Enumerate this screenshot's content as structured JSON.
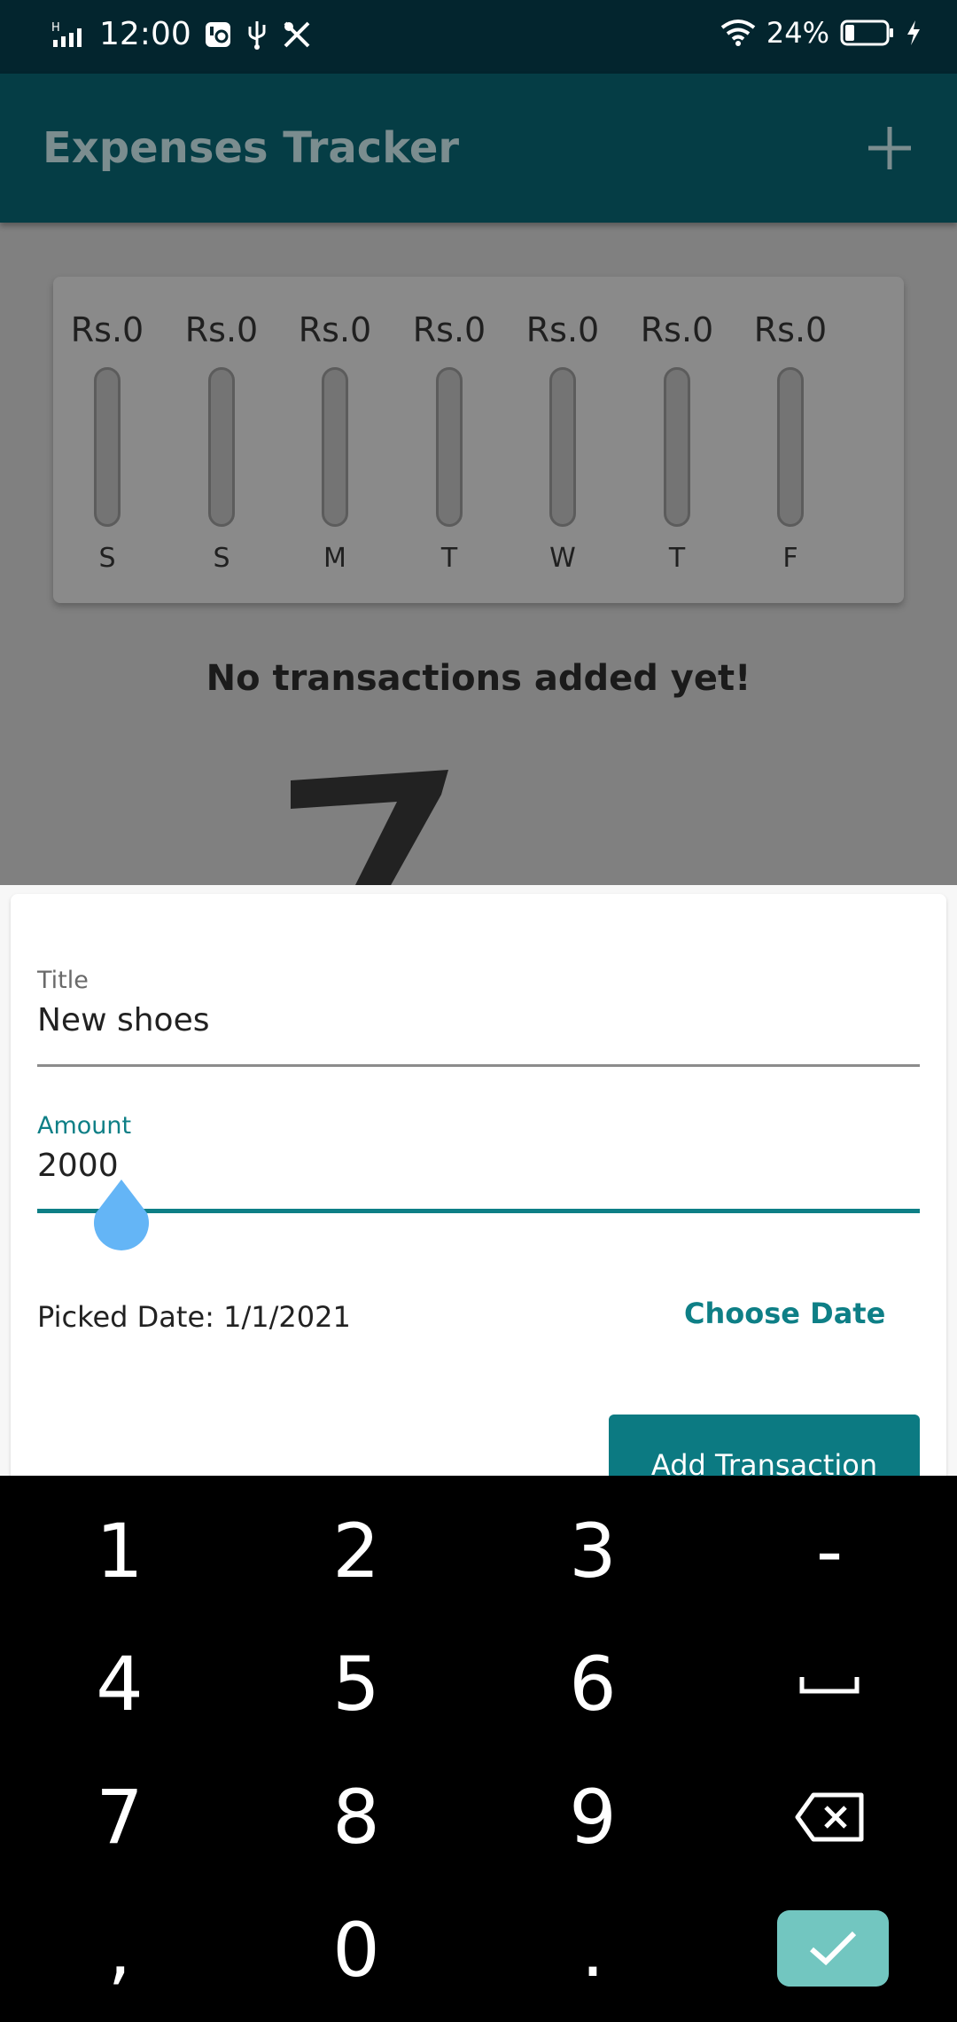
{
  "status_bar": {
    "time": "12:00",
    "battery_percent": "24%",
    "network": "H",
    "icons": [
      "signal-icon",
      "settings-chip-icon",
      "usb-icon",
      "tools-icon",
      "wifi-icon",
      "battery-icon",
      "charging-icon"
    ]
  },
  "app_bar": {
    "title": "Expenses Tracker",
    "add_icon": "plus-icon"
  },
  "chart": {
    "bars": [
      {
        "amount": "Rs.0",
        "day": "S",
        "fill_fraction": 0
      },
      {
        "amount": "Rs.0",
        "day": "S",
        "fill_fraction": 0
      },
      {
        "amount": "Rs.0",
        "day": "M",
        "fill_fraction": 0
      },
      {
        "amount": "Rs.0",
        "day": "T",
        "fill_fraction": 0
      },
      {
        "amount": "Rs.0",
        "day": "W",
        "fill_fraction": 0
      },
      {
        "amount": "Rs.0",
        "day": "T",
        "fill_fraction": 0
      },
      {
        "amount": "Rs.0",
        "day": "F",
        "fill_fraction": 0
      }
    ]
  },
  "empty_state": {
    "message": "No transactions added yet!"
  },
  "form": {
    "title_label": "Title",
    "title_value": "New shoes",
    "amount_label": "Amount",
    "amount_value": "2000",
    "picked_date": "Picked Date: 1/1/2021",
    "choose_date": "Choose Date",
    "submit": "Add Transaction"
  },
  "keyboard": {
    "keys": [
      "1",
      "2",
      "3",
      "-",
      "4",
      "5",
      "6",
      "␣",
      "7",
      "8",
      "9",
      "⌫",
      ",",
      "0",
      "."
    ],
    "confirm_icon": "check-icon"
  },
  "colors": {
    "status_bar": "#03252e",
    "app_bar": "#053d45",
    "accent": "#0e7f86",
    "handle": "#64b5f6",
    "confirm_key": "#72c6c0"
  }
}
